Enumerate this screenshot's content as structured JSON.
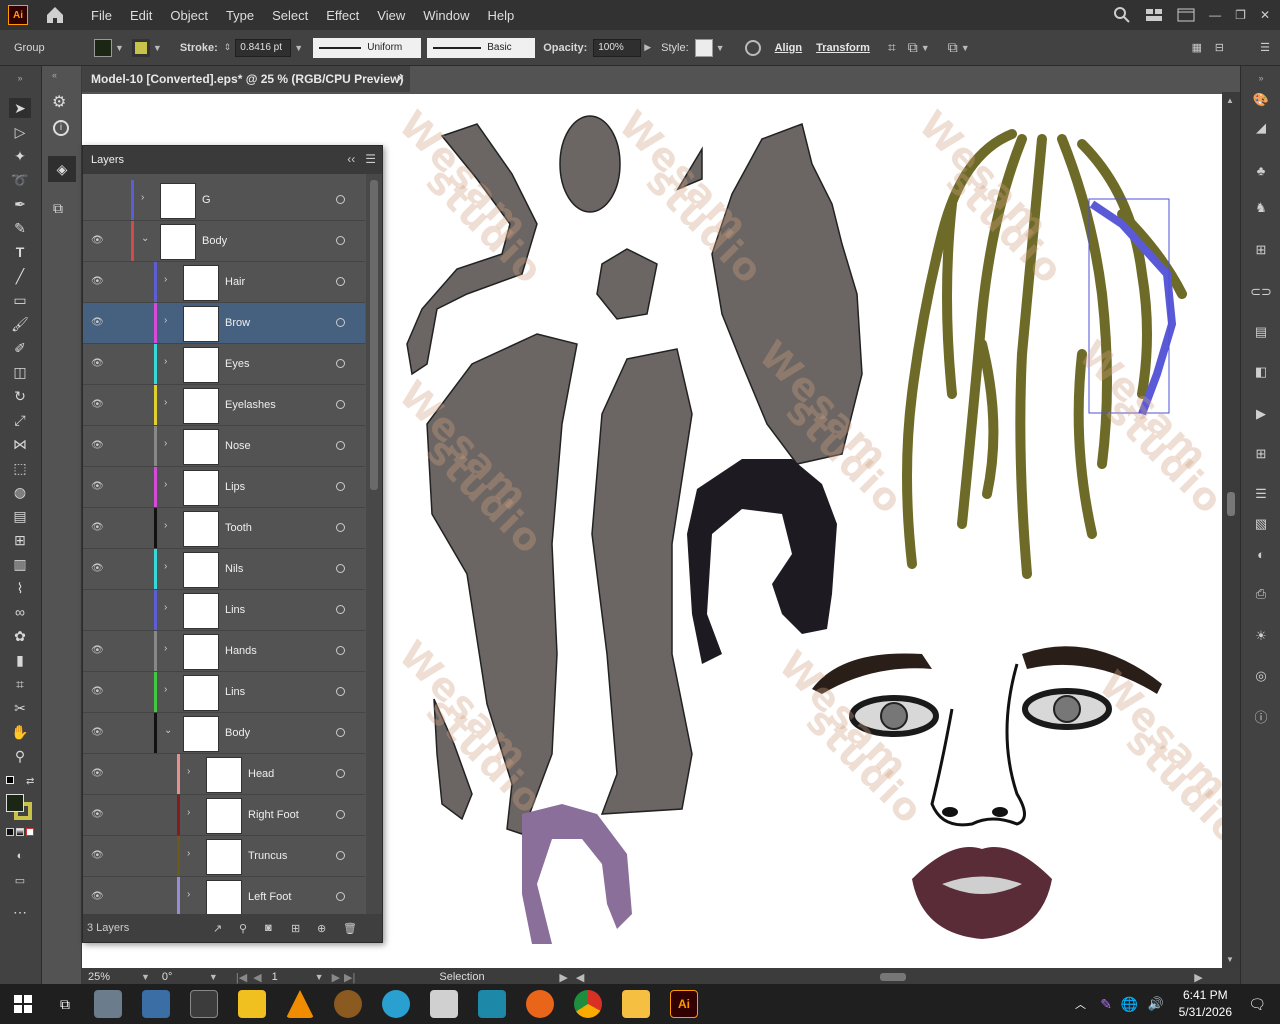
{
  "app": {
    "logo": "Ai",
    "menus": [
      "File",
      "Edit",
      "Object",
      "Type",
      "Select",
      "Effect",
      "View",
      "Window",
      "Help"
    ]
  },
  "control_bar": {
    "selection_type": "Group",
    "fill_color": "#1c2614",
    "stroke_swatch_color": "#c9c24a",
    "stroke_label": "Stroke:",
    "stroke_weight": "0.8416 pt",
    "stroke_profile": "Uniform",
    "brush": "Basic",
    "opacity_label": "Opacity:",
    "opacity_value": "100%",
    "style_label": "Style:",
    "align_label": "Align",
    "transform_label": "Transform"
  },
  "document": {
    "tab_title": "Model-10 [Converted].eps* @ 25 % (RGB/CPU Preview)",
    "close_symbol": "×"
  },
  "layers_panel": {
    "title": "Layers",
    "footer_count": "3 Layers",
    "rows": [
      {
        "name": "G",
        "color": "#5e5ed4"
      },
      {
        "name": "Body",
        "color": "#d24b4b"
      },
      {
        "name": "Hair",
        "color": "#5e5ed4"
      },
      {
        "name": "Brow",
        "color": "#d34bd6"
      },
      {
        "name": "Eyes",
        "color": "#38d8d8"
      },
      {
        "name": "Eyelashes",
        "color": "#e0d030"
      },
      {
        "name": "Nose",
        "color": "#888888"
      },
      {
        "name": "Lips",
        "color": "#d34bd6"
      },
      {
        "name": "Tooth",
        "color": "#111111"
      },
      {
        "name": "Nils",
        "color": "#38d8d8"
      },
      {
        "name": "Lins",
        "color": "#5e5ed4"
      },
      {
        "name": "Hands",
        "color": "#888888"
      },
      {
        "name": "Lins",
        "color": "#44c844"
      },
      {
        "name": "Body",
        "color": "#111111"
      },
      {
        "name": "Head",
        "color": "#e89090"
      },
      {
        "name": "Right Foot",
        "color": "#8a1a1a"
      },
      {
        "name": "Truncus",
        "color": "#6a5a1a"
      },
      {
        "name": "Left Foot",
        "color": "#9a8ad8"
      }
    ]
  },
  "status_bar": {
    "zoom": "25%",
    "rotation": "0°",
    "artboard_number": "1",
    "tool": "Selection"
  },
  "canvas": {
    "watermark_word_1": "Wesam",
    "watermark_word_2": "studio"
  },
  "taskbar": {
    "time": "6:41 PM",
    "date": "5/31/2026"
  }
}
